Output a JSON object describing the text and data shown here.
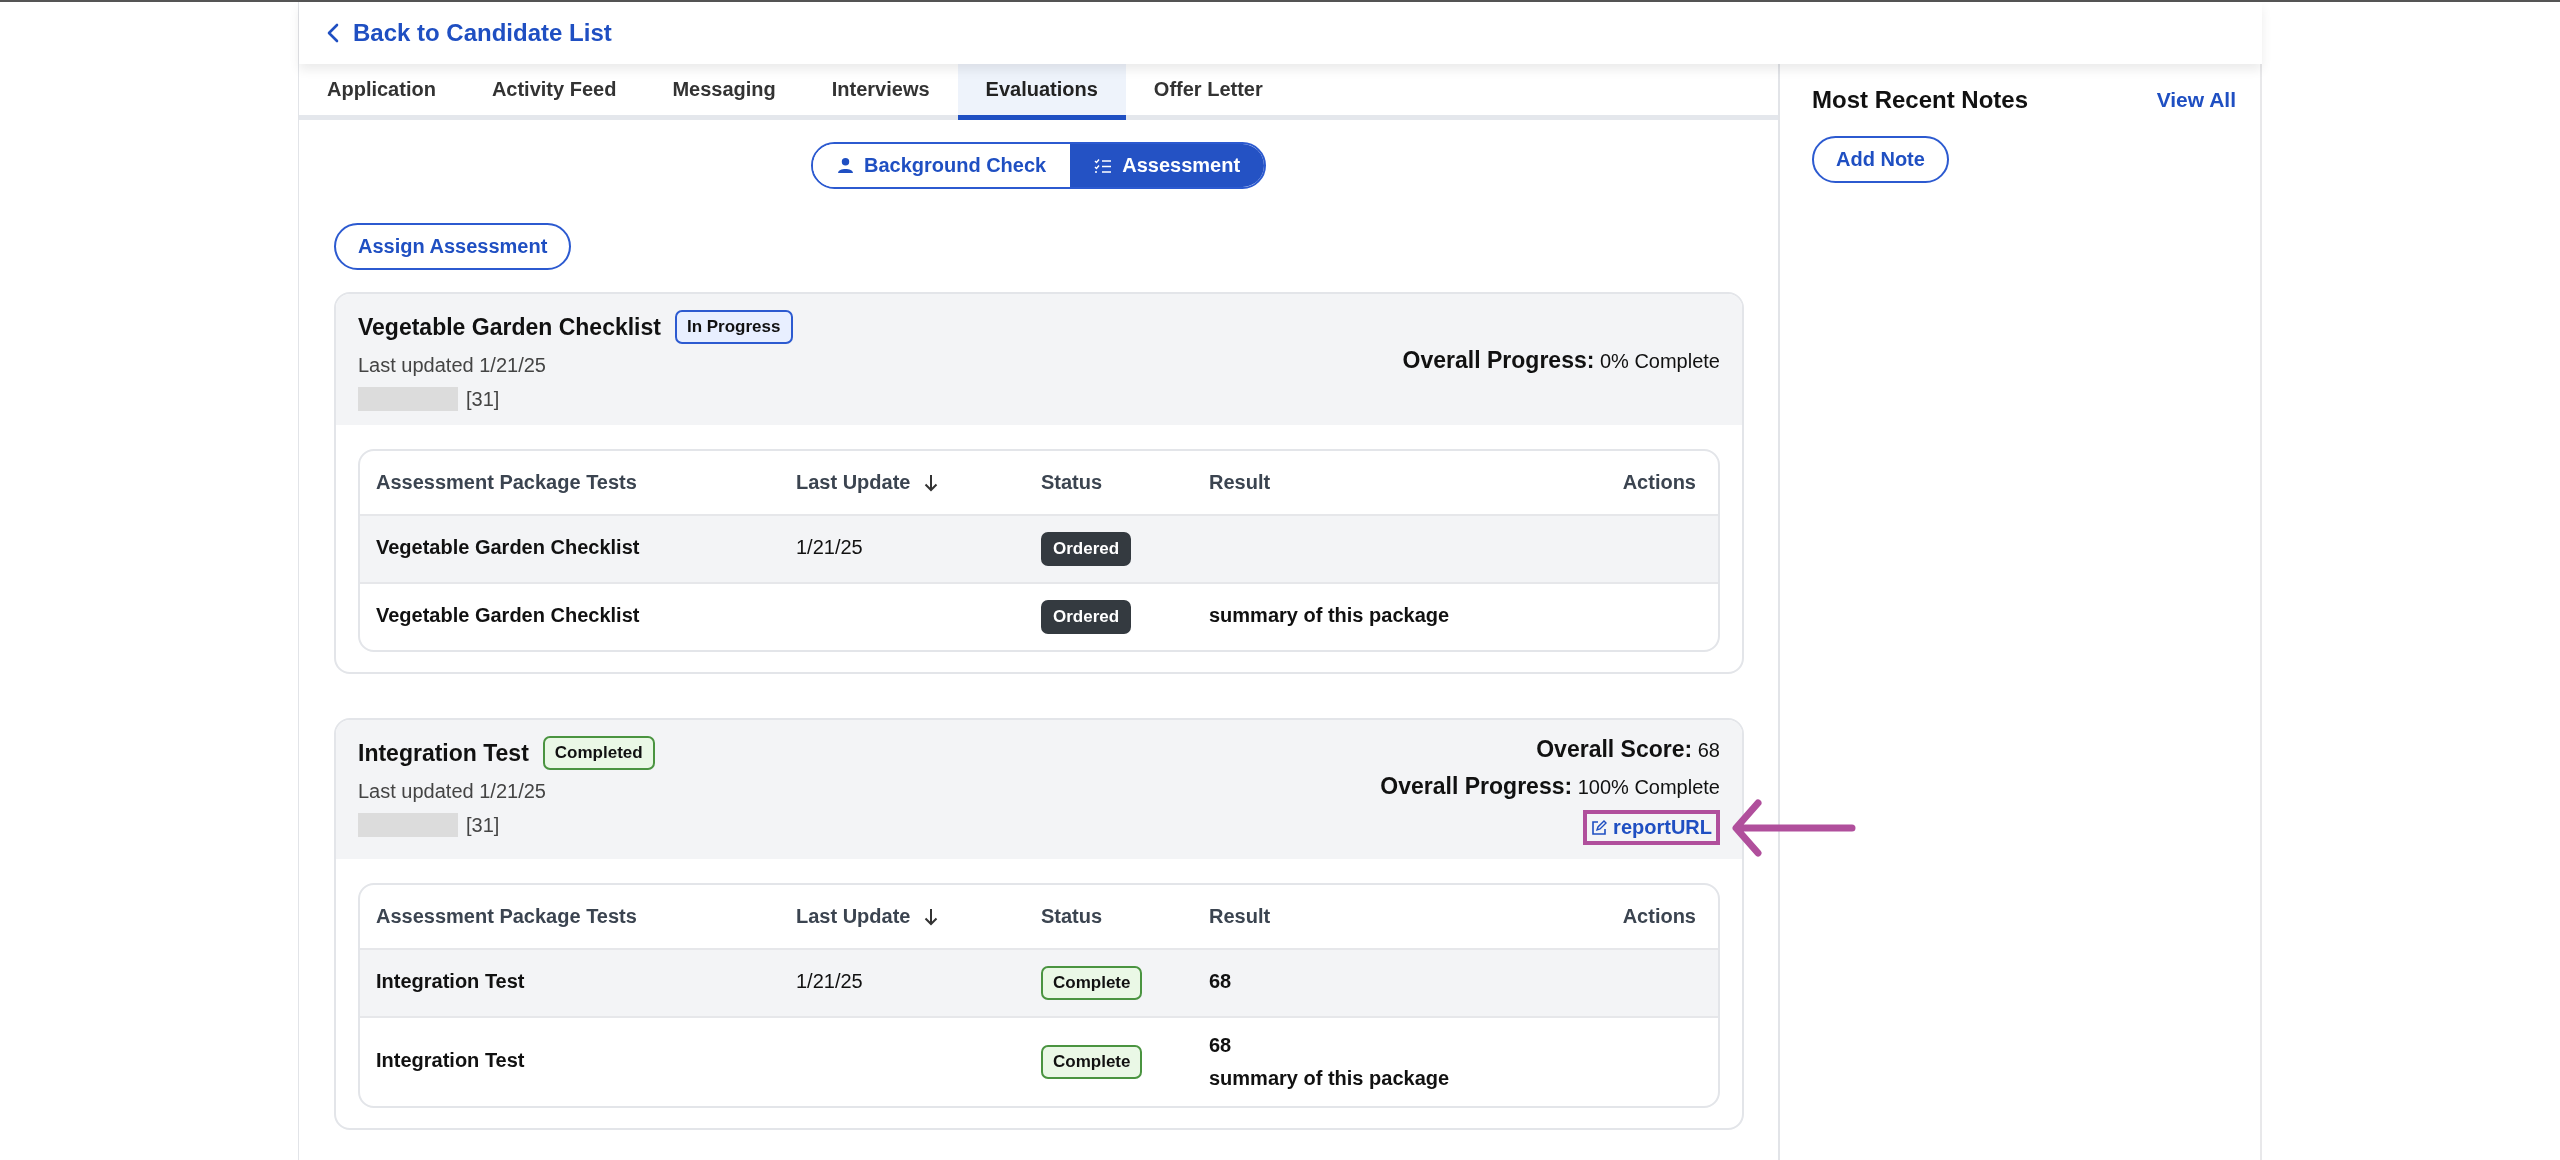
{
  "header": {
    "back_link": "Back to Candidate List"
  },
  "tabs": [
    {
      "label": "Application",
      "selected": false
    },
    {
      "label": "Activity Feed",
      "selected": false
    },
    {
      "label": "Messaging",
      "selected": false
    },
    {
      "label": "Interviews",
      "selected": false
    },
    {
      "label": "Evaluations",
      "selected": true
    },
    {
      "label": "Offer Letter",
      "selected": false
    }
  ],
  "segments": [
    {
      "label": "Background Check",
      "kind": "person",
      "selected": false
    },
    {
      "label": "Assessment",
      "kind": "checklist",
      "selected": true
    }
  ],
  "assign_button": "Assign Assessment",
  "assessments": [
    {
      "title": "Vegetable Garden Checklist",
      "status": {
        "label": "In Progress",
        "kind": "progress"
      },
      "last_updated": "Last updated 1/21/25",
      "redacted": true,
      "count": "[31]",
      "progress": {
        "label": "Overall Progress:",
        "value": "0% Complete"
      },
      "columns": [
        {
          "label": "Assessment Package Tests",
          "sorted": false
        },
        {
          "label": "Last Update",
          "sorted": true
        },
        {
          "label": "Status",
          "sorted": false
        },
        {
          "label": "Result",
          "sorted": false
        },
        {
          "label": "Actions",
          "sorted": false
        }
      ],
      "rows": [
        {
          "name": "Vegetable Garden Checklist",
          "date": "1/21/25",
          "status": {
            "label": "Ordered",
            "kind": "ordered"
          },
          "result": [],
          "emphasized": true
        },
        {
          "name": "Vegetable Garden Checklist",
          "status": {
            "label": "Ordered",
            "kind": "ordered"
          },
          "result": [
            "summary of this package"
          ],
          "emphasized": false
        }
      ]
    },
    {
      "title": "Integration Test",
      "status": {
        "label": "Completed",
        "kind": "complete"
      },
      "last_updated": "Last updated 1/21/25",
      "redacted": true,
      "count": "[31]",
      "score": {
        "label": "Overall Score:",
        "value": "68"
      },
      "progress": {
        "label": "Overall Progress:",
        "value": "100% Complete"
      },
      "report_link": {
        "label": "reportURL",
        "highlighted": true
      },
      "columns": [
        {
          "label": "Assessment Package Tests",
          "sorted": false
        },
        {
          "label": "Last Update",
          "sorted": true
        },
        {
          "label": "Status",
          "sorted": false
        },
        {
          "label": "Result",
          "sorted": false
        },
        {
          "label": "Actions",
          "sorted": false
        }
      ],
      "rows": [
        {
          "name": "Integration Test",
          "date": "1/21/25",
          "status": {
            "label": "Complete",
            "kind": "complete"
          },
          "result": [
            "68"
          ],
          "emphasized": true
        },
        {
          "name": "Integration Test",
          "status": {
            "label": "Complete",
            "kind": "complete"
          },
          "result": [
            "68",
            "summary of this package"
          ],
          "emphasized": false
        }
      ]
    }
  ],
  "notes": {
    "title": "Most Recent Notes",
    "view_all": "View All",
    "add_button": "Add Note"
  }
}
